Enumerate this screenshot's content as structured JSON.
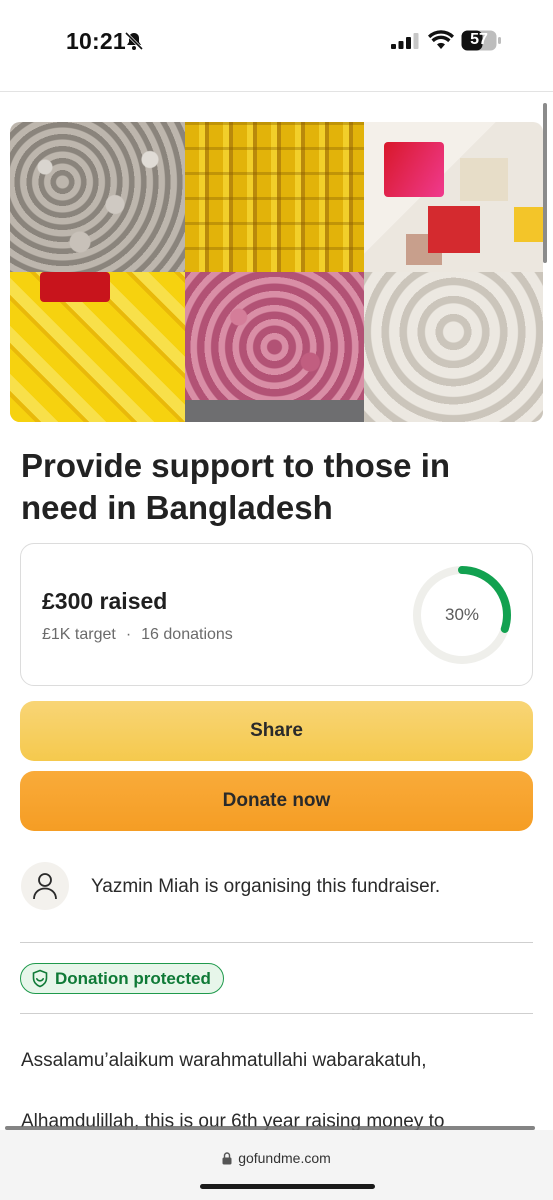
{
  "status_bar": {
    "time": "10:21",
    "battery": "57",
    "icons": [
      "bell-slash-icon",
      "cellular-signal-icon",
      "wifi-icon",
      "battery-icon"
    ]
  },
  "hero": {
    "tiles": [
      "onions-bags",
      "cooking-oil-bottles",
      "food-parcel-items",
      "yellow-packets",
      "red-onion-bags",
      "rice-bags"
    ]
  },
  "campaign": {
    "title": "Provide support to those in need in Bangladesh",
    "raised": "£300 raised",
    "target": "£1K target",
    "separator": "·",
    "donations": "16 donations",
    "progress_label": "30%",
    "progress_fraction": 0.3
  },
  "actions": {
    "share": "Share",
    "donate": "Donate now"
  },
  "organiser": {
    "text": "Yazmin Miah is organising this fundraiser."
  },
  "badge": {
    "label": "Donation protected"
  },
  "story": {
    "line1": "Assalamu’alaikum warahmatullahi wabarakatuh,",
    "line2": "Alhamdulillah, this is our 6th year raising money to"
  },
  "browser": {
    "url": "gofundme.com"
  },
  "colors": {
    "progress_green": "#12a150",
    "ring_track": "#efefeb",
    "share_yellow": "#f6cd5d",
    "donate_orange": "#f7a22e",
    "badge_green": "#1f9a4c"
  }
}
